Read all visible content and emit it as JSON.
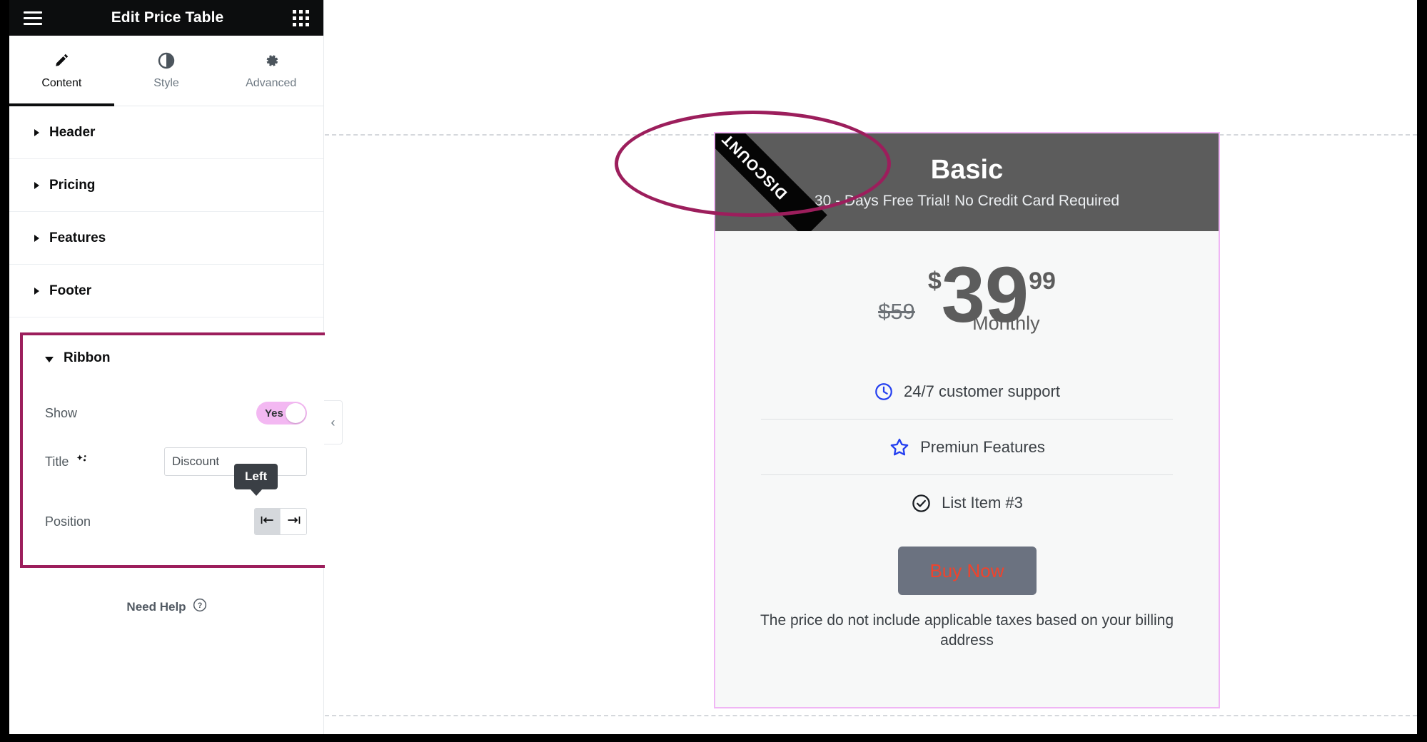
{
  "panel": {
    "title": "Edit Price Table",
    "menu_icon": "hamburger-icon",
    "apps_icon": "apps-grid-icon",
    "tabs": [
      {
        "label": "Content",
        "icon": "pencil-icon",
        "active": true
      },
      {
        "label": "Style",
        "icon": "contrast-circle-icon",
        "active": false
      },
      {
        "label": "Advanced",
        "icon": "gear-icon",
        "active": false
      }
    ],
    "sections": [
      {
        "label": "Header",
        "open": false
      },
      {
        "label": "Pricing",
        "open": false
      },
      {
        "label": "Features",
        "open": false
      },
      {
        "label": "Footer",
        "open": false
      }
    ],
    "ribbon_section": {
      "label": "Ribbon",
      "open": true,
      "show": {
        "label": "Show",
        "value": "Yes",
        "on": true
      },
      "title": {
        "label": "Title",
        "ai_icon": "ai-sparkle-icon",
        "value": "Discount",
        "placeholder": "Discount",
        "dynamic_icon": "dynamic-tags-database-icon"
      },
      "position": {
        "label": "Position",
        "options": [
          "Left",
          "Right"
        ],
        "selected": "Left",
        "left_icon": "align-left-icon",
        "right_icon": "align-right-icon"
      }
    },
    "tooltip": {
      "text": "Left"
    },
    "need_help": {
      "label": "Need Help",
      "icon": "question-circle-icon"
    },
    "collapse_handle": {
      "icon": "chevron-left-icon"
    }
  },
  "canvas": {
    "add_left": {
      "icon": "plus-icon"
    },
    "add_right": {
      "icon": "plus-icon"
    },
    "card": {
      "ribbon_text": "DISCOUNT",
      "heading": "Basic",
      "subheading": "30 - Days Free Trial! No Credit Card Required",
      "price": {
        "original": "$59",
        "currency": "$",
        "integer": "39",
        "fraction": "99",
        "period": "Monthly"
      },
      "features": [
        {
          "icon": "clock-icon",
          "label": "24/7 customer support"
        },
        {
          "icon": "star-outline-icon",
          "label": "Premiun Features"
        },
        {
          "icon": "check-circle-icon",
          "label": "List Item #3"
        }
      ],
      "cta": {
        "label": "Buy Now"
      },
      "footer_note": "The price do not include applicable taxes based on your billing address"
    }
  },
  "colors": {
    "annotation": "#9c1e5c",
    "toggle_on": "#f3b8f2",
    "card_border": "#f0b6f5",
    "card_header_bg": "#5c5c5c",
    "cta_bg": "#6b7280",
    "cta_text": "#f0432c",
    "feature_icon_blue": "#2540f0",
    "panel_header_bg": "#0c0d0e"
  }
}
